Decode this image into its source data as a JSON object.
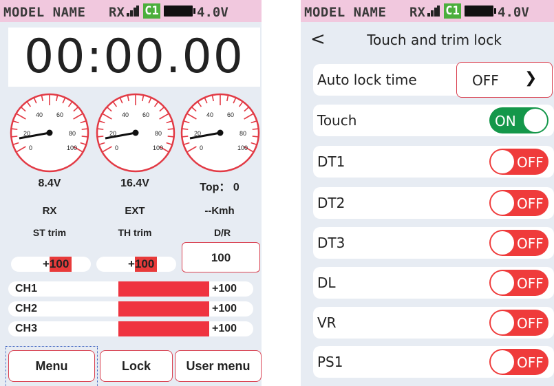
{
  "status": {
    "model_name": "MODEL NAME",
    "rx": "RX",
    "channel": "C1",
    "voltage": "4.0V"
  },
  "left": {
    "timer": "00:00.00",
    "gauge_ticks": [
      "20",
      "40",
      "60",
      "80",
      "100",
      "0"
    ],
    "gauges": [
      {
        "value": "8.4V",
        "label": "RX"
      },
      {
        "value": "16.4V",
        "label": "EXT"
      },
      {
        "value": "Top： 0",
        "label": "--Kmh"
      }
    ],
    "trims": [
      {
        "label": "ST trim",
        "value": "+100"
      },
      {
        "label": "TH trim",
        "value": "+100"
      }
    ],
    "dr": {
      "label": "D/R",
      "value": "100"
    },
    "channels": [
      {
        "name": "CH1",
        "value": "+100"
      },
      {
        "name": "CH2",
        "value": "+100"
      },
      {
        "name": "CH3",
        "value": "+100"
      }
    ],
    "buttons": {
      "menu": "Menu",
      "lock": "Lock",
      "user_menu": "User menu"
    }
  },
  "right": {
    "back": "<",
    "title": "Touch and trim lock",
    "auto_lock": {
      "label": "Auto lock time",
      "value": "OFF"
    },
    "items": [
      {
        "label": "Touch",
        "state": "ON"
      },
      {
        "label": "DT1",
        "state": "OFF"
      },
      {
        "label": "DT2",
        "state": "OFF"
      },
      {
        "label": "DT3",
        "state": "OFF"
      },
      {
        "label": "DL",
        "state": "OFF"
      },
      {
        "label": "VR",
        "state": "OFF"
      },
      {
        "label": "PS1",
        "state": "OFF"
      }
    ]
  },
  "colors": {
    "accent_red": "#ef3340",
    "toggle_on": "#14974a",
    "status_bar": "#f1c8de",
    "channel_badge": "#4cae3c"
  }
}
